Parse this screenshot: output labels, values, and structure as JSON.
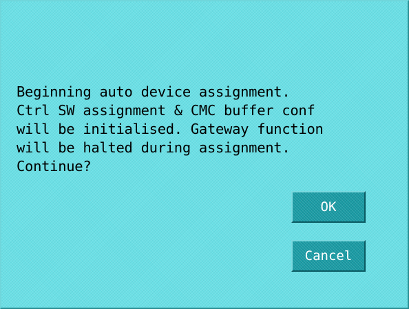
{
  "dialog": {
    "message_lines": [
      "Beginning auto device assignment.",
      "Ctrl SW assignment & CMC buffer conf",
      "will be initialised. Gateway function",
      "will be halted during assignment.",
      "Continue?"
    ],
    "ok_label": "OK",
    "cancel_label": "Cancel"
  },
  "colors": {
    "background": "#6be0e6",
    "button": "#1a9ca5",
    "button_text": "#ffffff",
    "text": "#000000"
  }
}
